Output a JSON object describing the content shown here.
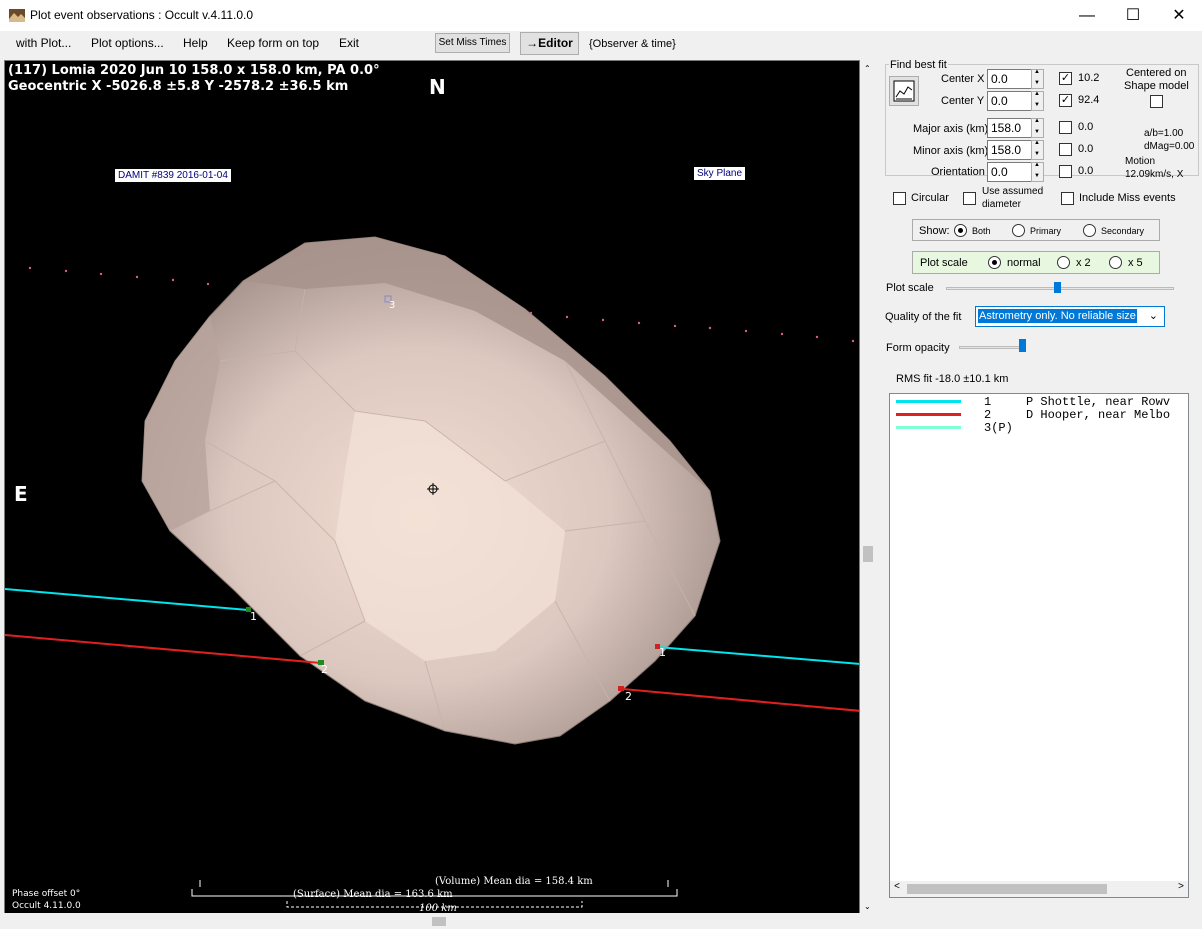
{
  "window": {
    "title": "Plot event observations : Occult v.4.11.0.0"
  },
  "menu": {
    "with_plot": "with Plot...",
    "plot_options": "Plot options...",
    "help": "Help",
    "keep_on_top": "Keep form on top",
    "exit": "Exit",
    "set_miss_times": "Set Miss Times",
    "editor": "→Editor",
    "observer_time": "{Observer & time}"
  },
  "plot": {
    "header_line1": "(117) Lomia  2020 Jun 10  158.0 x 158.0 km, PA 0.0°",
    "header_line2": "Geocentric  X  -5026.8 ±5.8  Y -2578.2 ±36.5 km",
    "north": "N",
    "east": "E",
    "damit_label": "DAMIT #839 2016-01-04",
    "sky_plane": "Sky Plane",
    "chord_labels": [
      "1",
      "2",
      "1",
      "2",
      "3"
    ],
    "volume_dia": "(Volume) Mean dia = 158.4 km",
    "surface_dia": "(Surface) Mean dia = 163.6 km",
    "scale_km": "100 km",
    "phase_offset": "Phase offset 0°",
    "version": "Occult 4.11.0.0",
    "colors": {
      "chord1": "#00e5ee",
      "chord2": "#e02020",
      "background": "#000000"
    }
  },
  "panel": {
    "find_best_fit": "Find best fit",
    "center_x_label": "Center X",
    "center_x": "0.0",
    "center_x_check": "10.2",
    "center_y_label": "Center Y",
    "center_y": "0.0",
    "center_y_check": "92.4",
    "centered_on": "Centered on",
    "shape_model": "Shape model",
    "major_label": "Major axis (km)",
    "major": "158.0",
    "major_check": "0.0",
    "minor_label": "Minor axis (km)",
    "minor": "158.0",
    "minor_check": "0.0",
    "orientation_label": "Orientation",
    "orientation": "0.0",
    "orientation_check": "0.0",
    "ab": "a/b=1.00",
    "dmag": "dMag=0.00",
    "motion": "Motion",
    "motion_value": "12.09km/s, X",
    "circular": "Circular",
    "use_assumed": "Use assumed",
    "diameter": "diameter",
    "include_miss": "Include Miss events",
    "show_label": "Show:",
    "show_both": "Both",
    "show_primary": "Primary",
    "show_secondary": "Secondary",
    "plot_scale_label": "Plot scale",
    "scale_normal": "normal",
    "scale_x2": "x 2",
    "scale_x5": "x 5",
    "plot_scale_slider_label": "Plot scale",
    "quality_label": "Quality of the fit",
    "quality_value": "Astrometry only. No reliable size",
    "form_opacity": "Form opacity",
    "rms_fit": "RMS fit -18.0 ±10.1 km",
    "observers": [
      {
        "num": "1",
        "name": "P Shottle, near Rowv",
        "color": "#00e5ee"
      },
      {
        "num": "2",
        "name": "D Hooper, near Melbo",
        "color": "#e02020"
      },
      {
        "num": "3(P)",
        "name": "",
        "color": "#7fffd4"
      }
    ]
  }
}
